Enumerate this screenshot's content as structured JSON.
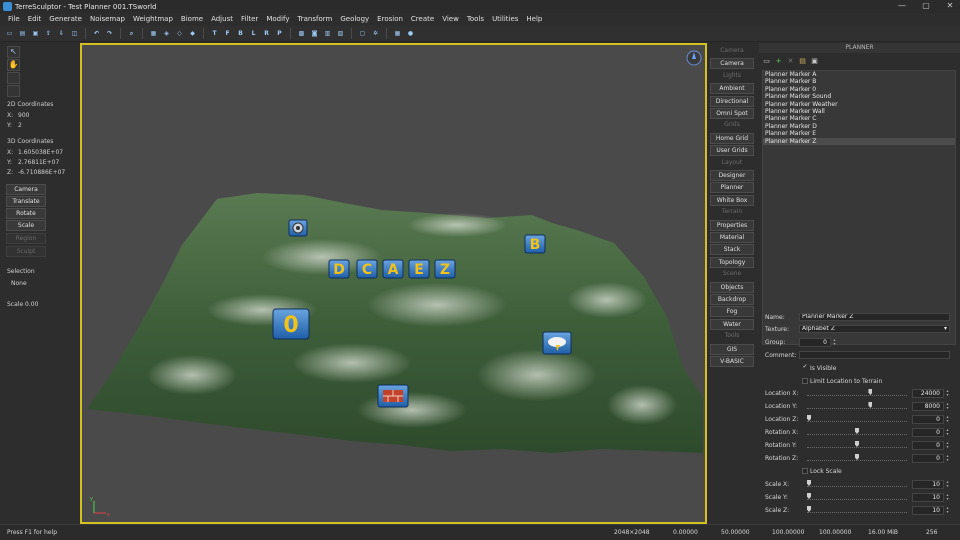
{
  "window": {
    "title": "TerreSculptor - Test Planner 001.TSworld",
    "controls": [
      "—",
      "▢",
      "✕"
    ]
  },
  "menu": [
    "File",
    "Edit",
    "Generate",
    "Noisemap",
    "Weightmap",
    "Biome",
    "Adjust",
    "Filter",
    "Modify",
    "Transform",
    "Geology",
    "Erosion",
    "Create",
    "View",
    "Tools",
    "Utilities",
    "Help"
  ],
  "toolbar": {
    "buttons": [
      "new-icon",
      "open-icon",
      "save-icon",
      "export-icon",
      "import-icon",
      "select-icon",
      "undo-icon",
      "redo-icon",
      "zoom-icon",
      "grid-icon",
      "view-3d-icon",
      "view-2d-icon",
      "letter-t",
      "letter-f",
      "letter-b",
      "letter-l",
      "letter-r",
      "letter-p",
      "render-icon",
      "camera-icon",
      "layers-icon",
      "display-icon",
      "settings-icon",
      "globe-icon"
    ],
    "letters": {
      "t": "T",
      "f": "F",
      "b": "B",
      "l": "L",
      "r": "R",
      "p": "P"
    }
  },
  "left": {
    "coords2d_title": "2D Coordinates",
    "x_label": "X:",
    "x_value": "900",
    "y_label": "Y:",
    "y_value": "2",
    "coords3d_title": "3D Coordinates",
    "x3_label": "X:",
    "x3_value": "1.605038E+07",
    "y3_label": "Y:",
    "y3_value": "2.76811E+07",
    "z3_label": "Z:",
    "z3_value": "-6.710886E+07",
    "buttons": [
      "Camera",
      "Translate",
      "Rotate",
      "Scale",
      "Region",
      "Sculpt"
    ],
    "selection_label": "Selection",
    "selection_value": "None",
    "scale_text": "Scale 0.00"
  },
  "mid": [
    {
      "text": "Camera",
      "type": "header"
    },
    {
      "text": "Camera",
      "type": "btn"
    },
    {
      "text": "Lights",
      "type": "header"
    },
    {
      "text": "Ambient",
      "type": "btn"
    },
    {
      "text": "Directional",
      "type": "btn"
    },
    {
      "text": "Omni Spot",
      "type": "btn"
    },
    {
      "text": "Grids",
      "type": "header"
    },
    {
      "text": "Home Grid",
      "type": "btn"
    },
    {
      "text": "User Grids",
      "type": "btn"
    },
    {
      "text": "Layout",
      "type": "header"
    },
    {
      "text": "Designer",
      "type": "btn"
    },
    {
      "text": "Planner",
      "type": "btn"
    },
    {
      "text": "White Box",
      "type": "btn"
    },
    {
      "text": "Terrain",
      "type": "header"
    },
    {
      "text": "Properties",
      "type": "btn"
    },
    {
      "text": "Material",
      "type": "btn"
    },
    {
      "text": "Stack",
      "type": "btn"
    },
    {
      "text": "Topology",
      "type": "btn"
    },
    {
      "text": "Scene",
      "type": "header"
    },
    {
      "text": "Objects",
      "type": "btn"
    },
    {
      "text": "Backdrop",
      "type": "btn"
    },
    {
      "text": "Fog",
      "type": "btn"
    },
    {
      "text": "Water",
      "type": "btn"
    },
    {
      "text": "Tools",
      "type": "header"
    },
    {
      "text": "GIS",
      "type": "btn"
    },
    {
      "text": "V-BASIC",
      "type": "btn"
    }
  ],
  "planner": {
    "title": "PLANNER",
    "markers": [
      "Planner Marker A",
      "Planner Marker B",
      "Planner Marker 0",
      "Planner Marker Sound",
      "Planner Marker Weather",
      "Planner Marker Wall",
      "Planner Marker C",
      "Planner Marker D",
      "Planner Marker E",
      "Planner Marker Z"
    ],
    "selected_index": 9,
    "name_label": "Name:",
    "name_value": "Planner Marker Z",
    "texture_label": "Texture:",
    "texture_value": "Alphabet Z",
    "group_label": "Group:",
    "group_value": "0",
    "comment_label": "Comment:",
    "comment_value": "",
    "visible_label": "Is Visible",
    "visible_checked": true,
    "limit_label": "Limit Location to Terrain",
    "limit_checked": false,
    "lock_label": "Lock Scale",
    "lock_checked": false,
    "rows": [
      {
        "label": "Location X:",
        "value": "24000",
        "level": 0.64
      },
      {
        "label": "Location Y:",
        "value": "8000",
        "level": 0.64
      },
      {
        "label": "Location Z:",
        "value": "0",
        "level": 0.0
      },
      {
        "label": "Rotation X:",
        "value": "0",
        "level": 0.5
      },
      {
        "label": "Rotation Y:",
        "value": "0",
        "level": 0.5
      },
      {
        "label": "Rotation Z:",
        "value": "0",
        "level": 0.5
      },
      {
        "label": "Scale X:",
        "value": "10",
        "level": 0.0
      },
      {
        "label": "Scale Y:",
        "value": "10",
        "level": 0.0
      },
      {
        "label": "Scale Z:",
        "value": "10",
        "level": 0.0
      }
    ]
  },
  "viewport": {
    "markers": [
      "D",
      "C",
      "A",
      "E",
      "Z",
      "B",
      "0"
    ],
    "axis_y": "y",
    "axis_x": "x"
  },
  "status": {
    "help": "Press F1 for help",
    "resolution": "2048×2048",
    "v1": "0.00000",
    "v2": "50.00000",
    "v3": "100.00000",
    "v4": "100.00000",
    "memory": "16.00 MiB",
    "count": "256"
  }
}
